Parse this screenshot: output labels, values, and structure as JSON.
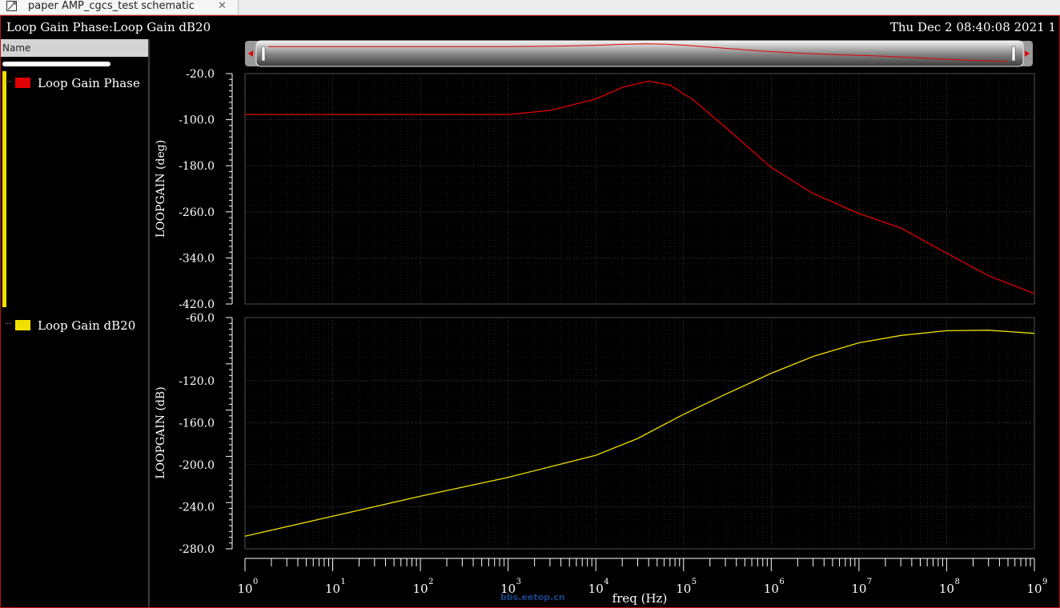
{
  "tab": {
    "title": "paper AMP_cgcs_test schematic",
    "close": "✕",
    "icon": "schematic-icon"
  },
  "window": {
    "title": "Loop Gain Phase:Loop Gain dB20",
    "date": "Thu Dec 2 08:40:08 2021  1"
  },
  "legend": {
    "header": "Name",
    "items": [
      {
        "label": "Loop Gain Phase",
        "color": "#e00000"
      },
      {
        "label": "Loop Gain dB20",
        "color": "#f0e000"
      }
    ]
  },
  "watermark": "bbs.eetop.cn",
  "chart_data": [
    {
      "type": "line",
      "title": "",
      "xlabel": "freq (Hz)",
      "ylabel": "LOOPGAIN (deg)",
      "xscale": "log",
      "xlim": [
        1,
        1000000000
      ],
      "ylim": [
        -420,
        -20
      ],
      "yticks": [
        "-20.0",
        "-100.0",
        "-180.0",
        "-260.0",
        "-340.0",
        "-420.0"
      ],
      "grid": true,
      "series": [
        {
          "name": "Loop Gain Phase",
          "color": "#e00000",
          "x": [
            1,
            10,
            100,
            1000,
            3000,
            10000,
            20000,
            40000,
            70000,
            130000,
            300000,
            1000000,
            3000000,
            10000000,
            30000000,
            100000000,
            300000000,
            1000000000
          ],
          "y": [
            -91,
            -91,
            -91,
            -91,
            -84,
            -64,
            -44,
            -33,
            -40,
            -66,
            -113,
            -183,
            -228,
            -263,
            -288,
            -332,
            -371,
            -402
          ]
        }
      ]
    },
    {
      "type": "line",
      "title": "",
      "xlabel": "freq (Hz)",
      "ylabel": "LOOPGAIN (dB)",
      "xscale": "log",
      "xlim": [
        1,
        1000000000
      ],
      "ylim": [
        -280,
        -60
      ],
      "yticks": [
        "-60.0",
        "-120.0",
        "-160.0",
        "-200.0",
        "-240.0",
        "-280.0"
      ],
      "xticks": [
        "10",
        "10",
        "10",
        "10",
        "10",
        "10",
        "10",
        "10",
        "10",
        "10"
      ],
      "xtick_exponents": [
        "0",
        "1",
        "2",
        "3",
        "4",
        "5",
        "6",
        "7",
        "8",
        "9"
      ],
      "grid": true,
      "series": [
        {
          "name": "Loop Gain dB20",
          "color": "#f0e000",
          "x": [
            1,
            10,
            100,
            1000,
            10000,
            30000,
            100000,
            300000,
            1000000,
            3000000,
            10000000,
            30000000,
            100000000,
            300000000,
            1000000000
          ],
          "y": [
            -268,
            -249,
            -230,
            -212,
            -191,
            -175,
            -152,
            -133,
            -113,
            -97,
            -84,
            -77,
            -72.5,
            -72,
            -75
          ]
        }
      ]
    }
  ]
}
